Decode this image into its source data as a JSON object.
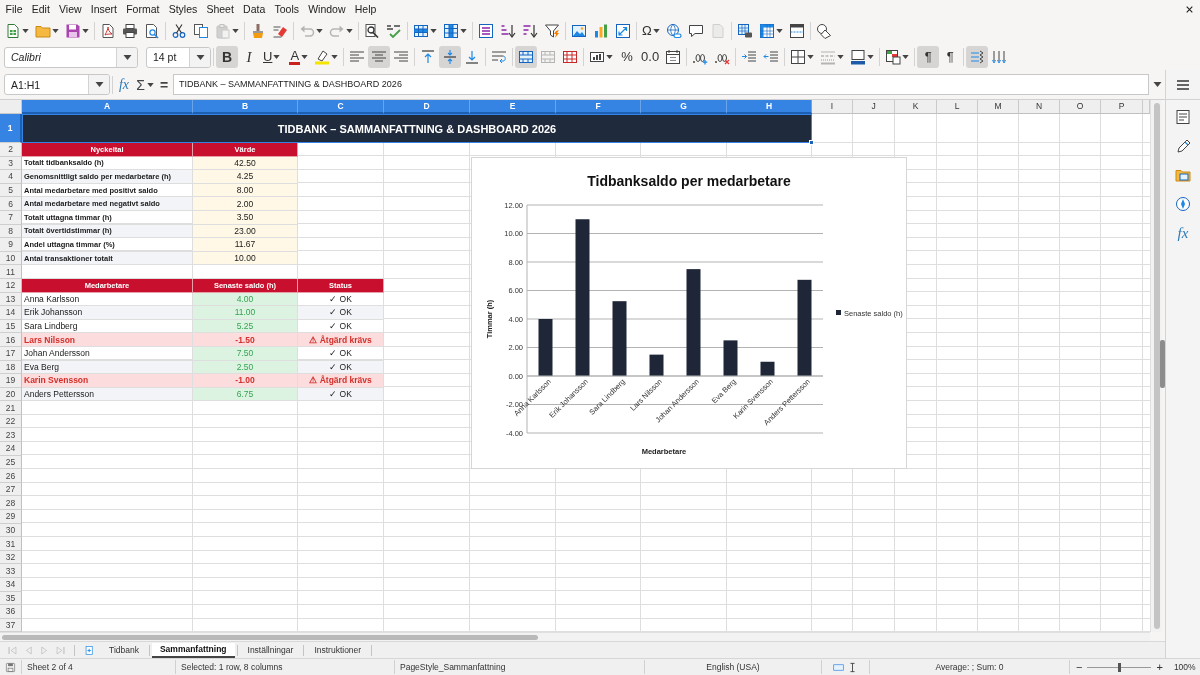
{
  "menu_bar": {
    "items": [
      "File",
      "Edit",
      "View",
      "Insert",
      "Format",
      "Styles",
      "Sheet",
      "Data",
      "Tools",
      "Window",
      "Help"
    ]
  },
  "standard_toolbar": {
    "buttons": {
      "paste": {
        "disabled": true
      },
      "undo": {
        "disabled": true
      },
      "redo": {
        "disabled": true
      },
      "special_character": {
        "label": "Ω"
      },
      "headers_footers": {
        "disabled": true
      }
    }
  },
  "formatting_toolbar": {
    "font_name": "Calibri",
    "font_size": "14 pt",
    "buttons": {
      "bold": {
        "label": "B",
        "on": true
      },
      "italic": {
        "label": "I",
        "on": false
      },
      "underline": {
        "label": "U",
        "on": false
      },
      "font_color": {
        "label": "A"
      },
      "align_left": {
        "on": false
      },
      "align_center": {
        "on": true
      },
      "align_right": {
        "on": false
      },
      "align_top": {
        "on": false
      },
      "align_middle": {
        "on": true
      },
      "align_bottom": {
        "on": false
      },
      "wrap_text": {
        "on": false
      },
      "merge_and_center": {
        "on": true
      },
      "merge_cells": {
        "disabled": true
      },
      "percent": {
        "label": "%"
      },
      "standard_format": {
        "label": "0.0"
      },
      "border_style": {
        "disabled": true
      },
      "left_to_right": {
        "label": "¶",
        "on": true
      },
      "right_to_left": {
        "label": "¶",
        "on": false
      },
      "text_horizontal": {
        "on": true
      },
      "text_vertical": {
        "on": false
      }
    }
  },
  "formula_bar": {
    "name_box": "A1:H1",
    "function_wizard_label": "fx",
    "sum_label": "Σ",
    "equals_label": "=",
    "formula": "TIDBANK – SAMMANFATTNING & DASHBOARD 2026"
  },
  "sheet": {
    "column_headers": [
      {
        "label": "A",
        "selected": true
      },
      {
        "label": "B",
        "selected": true
      },
      {
        "label": "C",
        "selected": true
      },
      {
        "label": "D",
        "selected": true
      },
      {
        "label": "E",
        "selected": true
      },
      {
        "label": "F",
        "selected": true
      },
      {
        "label": "G",
        "selected": true
      },
      {
        "label": "H",
        "selected": true
      },
      {
        "label": "I",
        "selected": false
      },
      {
        "label": "J",
        "selected": false
      },
      {
        "label": "K",
        "selected": false
      },
      {
        "label": "L",
        "selected": false
      },
      {
        "label": "M",
        "selected": false
      },
      {
        "label": "N",
        "selected": false
      },
      {
        "label": "O",
        "selected": false
      },
      {
        "label": "P",
        "selected": false
      }
    ],
    "row_headers": [
      {
        "label": "1",
        "selected": true
      },
      {
        "label": "2",
        "selected": false
      },
      {
        "label": "3",
        "selected": false
      },
      {
        "label": "4",
        "selected": false
      },
      {
        "label": "5",
        "selected": false
      },
      {
        "label": "6",
        "selected": false
      },
      {
        "label": "7",
        "selected": false
      },
      {
        "label": "8",
        "selected": false
      },
      {
        "label": "9",
        "selected": false
      },
      {
        "label": "10",
        "selected": false
      },
      {
        "label": "11",
        "selected": false
      },
      {
        "label": "12",
        "selected": false
      },
      {
        "label": "13",
        "selected": false
      },
      {
        "label": "14",
        "selected": false
      },
      {
        "label": "15",
        "selected": false
      },
      {
        "label": "16",
        "selected": false
      },
      {
        "label": "17",
        "selected": false
      },
      {
        "label": "18",
        "selected": false
      },
      {
        "label": "19",
        "selected": false
      },
      {
        "label": "20",
        "selected": false
      },
      {
        "label": "21",
        "selected": false
      },
      {
        "label": "22",
        "selected": false
      },
      {
        "label": "23",
        "selected": false
      },
      {
        "label": "24",
        "selected": false
      },
      {
        "label": "25",
        "selected": false
      },
      {
        "label": "26",
        "selected": false
      },
      {
        "label": "27",
        "selected": false
      },
      {
        "label": "28",
        "selected": false
      },
      {
        "label": "29",
        "selected": false
      },
      {
        "label": "30",
        "selected": false
      },
      {
        "label": "31",
        "selected": false
      },
      {
        "label": "32",
        "selected": false
      },
      {
        "label": "33",
        "selected": false
      },
      {
        "label": "34",
        "selected": false
      },
      {
        "label": "35",
        "selected": false
      },
      {
        "label": "36",
        "selected": false
      },
      {
        "label": "37",
        "selected": false
      }
    ],
    "title": "TIDBANK – SAMMANFATTNING & DASHBOARD 2026",
    "key_figures": {
      "header": [
        "Nyckeltal",
        "Värde"
      ],
      "rows": [
        {
          "label": "Totalt tidbanksaldo (h)",
          "value": "42.50"
        },
        {
          "label": "Genomsnittligt saldo per medarbetare (h)",
          "value": "4.25"
        },
        {
          "label": "Antal medarbetare med positivt saldo",
          "value": "8.00"
        },
        {
          "label": "Antal medarbetare med negativt saldo",
          "value": "2.00"
        },
        {
          "label": "Totalt uttagna timmar (h)",
          "value": "3.50"
        },
        {
          "label": "Totalt övertidstimmar (h)",
          "value": "23.00"
        },
        {
          "label": "Andel uttagna timmar (%)",
          "value": "11.67"
        },
        {
          "label": "Antal transaktioner totalt",
          "value": "10.00"
        }
      ]
    },
    "employees": {
      "header": [
        "Medarbetare",
        "Senaste saldo (h)",
        "Status"
      ],
      "rows": [
        {
          "name": "Anna Karlsson",
          "balance": "4.00",
          "status": "✓ OK",
          "kind": "ok"
        },
        {
          "name": "Erik Johansson",
          "balance": "11.00",
          "status": "✓ OK",
          "kind": "ok"
        },
        {
          "name": "Sara Lindberg",
          "balance": "5.25",
          "status": "✓ OK",
          "kind": "ok"
        },
        {
          "name": "Lars Nilsson",
          "balance": "-1.50",
          "status": "⚠ Åtgärd krävs",
          "kind": "alert"
        },
        {
          "name": "Johan Andersson",
          "balance": "7.50",
          "status": "✓ OK",
          "kind": "ok"
        },
        {
          "name": "Eva Berg",
          "balance": "2.50",
          "status": "✓ OK",
          "kind": "ok"
        },
        {
          "name": "Karin Svensson",
          "balance": "-1.00",
          "status": "⚠ Åtgärd krävs",
          "kind": "alert"
        },
        {
          "name": "Anders Pettersson",
          "balance": "6.75",
          "status": "✓ OK",
          "kind": "ok"
        }
      ]
    },
    "chart": {
      "chart_data": {
        "type": "bar",
        "title": "Tidbanksaldo per medarbetare",
        "xlabel": "Medarbetare",
        "ylabel": "Timmar (h)",
        "categories": [
          "Anna Karlsson",
          "Erik Johansson",
          "Sara Lindberg",
          "Lars Nilsson",
          "Johan Andersson",
          "Eva Berg",
          "Karin Svensson",
          "Anders Pettersson"
        ],
        "series": [
          {
            "name": "Senaste saldo (h)",
            "color": "#1f2638",
            "values": [
              4,
              11,
              5.25,
              1.5,
              7.5,
              2.5,
              1,
              6.75
            ]
          }
        ],
        "ylim": [
          -4,
          12
        ],
        "yticks": [
          {
            "value": -4,
            "label": "-4.00"
          },
          {
            "value": -2,
            "label": "-2.00"
          },
          {
            "value": 0,
            "label": "0.00"
          },
          {
            "value": 2,
            "label": "2.00"
          },
          {
            "value": 4,
            "label": "4.00"
          },
          {
            "value": 6,
            "label": "6.00"
          },
          {
            "value": 8,
            "label": "8.00"
          },
          {
            "value": 10,
            "label": "10.00"
          },
          {
            "value": 12,
            "label": "12.00"
          }
        ],
        "grid": true
      }
    }
  },
  "sheet_tabs": {
    "navigation_disabled": true,
    "tabs": [
      {
        "label": "Tidbank",
        "selected": false
      },
      {
        "label": "Sammanfattning",
        "selected": true
      },
      {
        "label": "Inställningar",
        "selected": false
      },
      {
        "label": "Instruktioner",
        "selected": false
      }
    ]
  },
  "sidebar": {
    "functions_label": "fx"
  },
  "status_bar": {
    "sheet_position": "Sheet 2 of 4",
    "selection": "Selected: 1 row, 8 columns",
    "page_style": "PageStyle_Sammanfattning",
    "language": "English (USA)",
    "summary": "Average: ; Sum: 0",
    "zoom_out_label": "−",
    "zoom_in_label": "+",
    "zoom": {
      "level": 0.5,
      "label": "100%"
    }
  }
}
